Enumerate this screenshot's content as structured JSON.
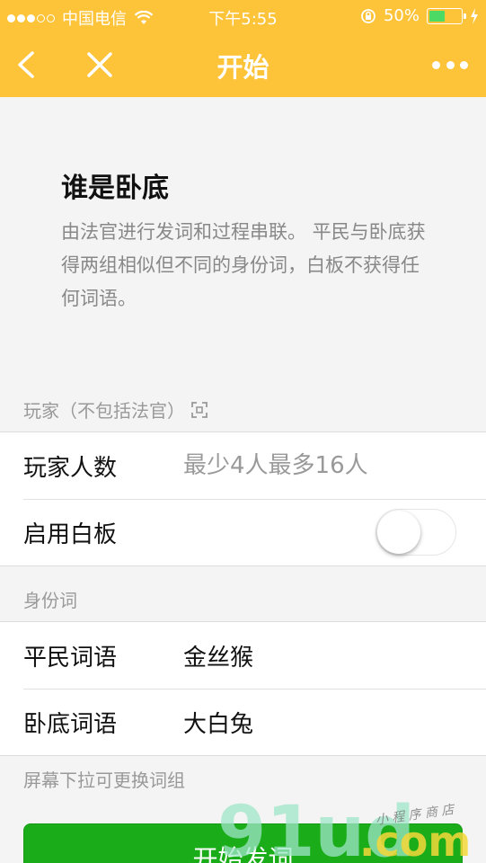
{
  "status_bar": {
    "carrier": "中国电信",
    "time": "下午5:55",
    "battery_percent": "50%",
    "battery_level": 0.5
  },
  "nav": {
    "title": "开始"
  },
  "intro": {
    "title": "谁是卧底",
    "description": "由法官进行发词和过程串联。 平民与卧底获得两组相似但不同的身份词，白板不获得任何词语。"
  },
  "players_section": {
    "header": "玩家（不包括法官）",
    "count_label": "玩家人数",
    "count_placeholder": "最少4人最多16人",
    "count_value": "",
    "blank_label": "启用白板",
    "blank_enabled": false
  },
  "words_section": {
    "header": "身份词",
    "civilian_label": "平民词语",
    "civilian_word": "金丝猴",
    "undercover_label": "卧底词语",
    "undercover_word": "大白兔"
  },
  "hint": "屏幕下拉可更换词组",
  "start_button": "开始发词",
  "watermark": {
    "logo_text": "91ud.com",
    "caption": "小程序商店"
  },
  "colors": {
    "nav_background": "#fdc43a",
    "primary_button": "#1aad19",
    "battery_fill": "#4cd964"
  }
}
